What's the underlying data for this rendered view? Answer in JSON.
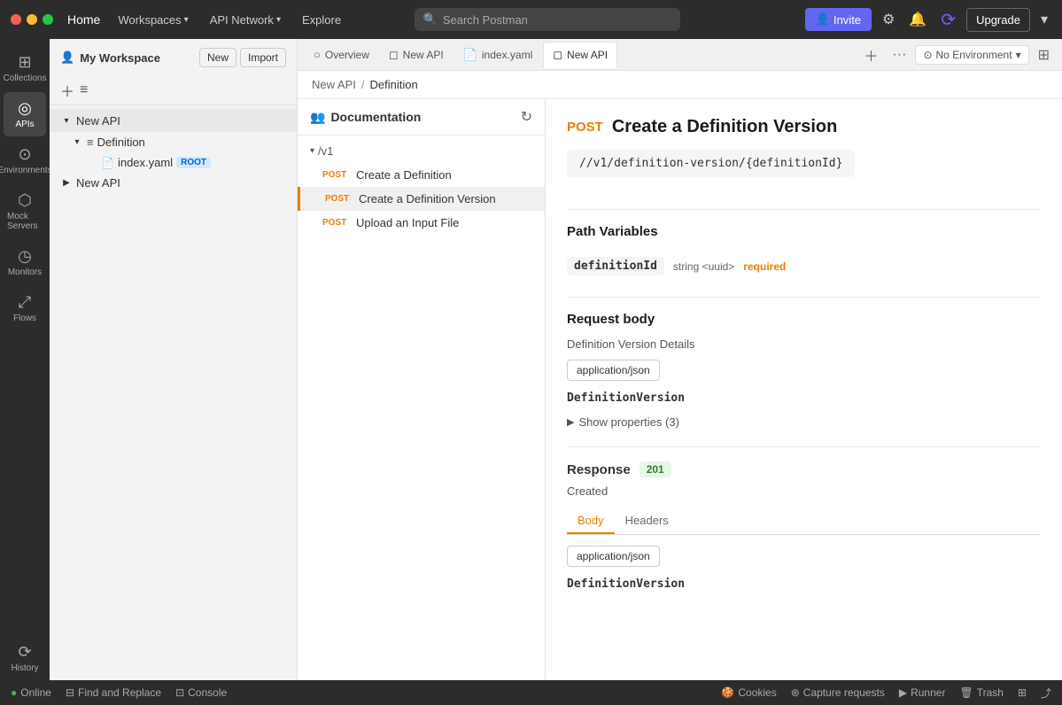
{
  "topnav": {
    "home": "Home",
    "workspaces": "Workspaces",
    "api_network": "API Network",
    "explore": "Explore",
    "search_placeholder": "Search Postman",
    "invite_label": "Invite",
    "upgrade_label": "Upgrade"
  },
  "sidebar": {
    "workspace_name": "My Workspace",
    "new_btn": "New",
    "import_btn": "Import",
    "icons": [
      {
        "id": "collections",
        "label": "Collections",
        "glyph": "⊞",
        "active": false
      },
      {
        "id": "apis",
        "label": "APIs",
        "glyph": "◎",
        "active": true
      },
      {
        "id": "environments",
        "label": "Environments",
        "glyph": "⊙",
        "active": false
      },
      {
        "id": "mock-servers",
        "label": "Mock Servers",
        "glyph": "⬡",
        "active": false
      },
      {
        "id": "monitors",
        "label": "Monitors",
        "glyph": "◷",
        "active": false
      },
      {
        "id": "flows",
        "label": "Flows",
        "glyph": "⤢",
        "active": false
      },
      {
        "id": "history",
        "label": "History",
        "glyph": "⟳",
        "active": false
      }
    ]
  },
  "tree": {
    "items": [
      {
        "id": "new-api-root",
        "label": "New API",
        "indent": 0,
        "chevron": "▾",
        "has_more": true
      },
      {
        "id": "definition",
        "label": "Definition",
        "indent": 1,
        "chevron": "▾",
        "icon": "≡"
      },
      {
        "id": "index-yaml",
        "label": "index.yaml",
        "indent": 2,
        "chevron": "",
        "icon": "📄",
        "tag": "ROOT"
      },
      {
        "id": "new-api-2",
        "label": "New API",
        "indent": 0,
        "chevron": "▶",
        "has_more": false
      }
    ]
  },
  "tabs": [
    {
      "id": "overview",
      "label": "Overview",
      "icon": "○",
      "active": false
    },
    {
      "id": "new-api-tab",
      "label": "New API",
      "icon": "◻",
      "active": false
    },
    {
      "id": "index-yaml-tab",
      "label": "index.yaml",
      "icon": "📄",
      "active": false
    },
    {
      "id": "new-api-active",
      "label": "New API",
      "icon": "◻",
      "active": true
    }
  ],
  "env_selector": {
    "label": "No Environment"
  },
  "breadcrumb": {
    "parent": "New API",
    "separator": "/",
    "current": "Definition"
  },
  "doc": {
    "title": "Documentation",
    "version": "/v1",
    "endpoints": [
      {
        "method": "POST",
        "label": "Create a Definition"
      },
      {
        "method": "POST",
        "label": "Create a Definition Version",
        "active": true
      },
      {
        "method": "POST",
        "label": "Upload an Input File"
      }
    ]
  },
  "detail": {
    "method": "POST",
    "title": "Create a Definition Version",
    "path": "//v1/definition-version/{definitionId}",
    "path_variables_title": "Path Variables",
    "path_var": {
      "name": "definitionId",
      "type": "string <uuid>",
      "required": "required"
    },
    "request_body_title": "Request body",
    "request_body_desc": "Definition Version Details",
    "content_type": "application/json",
    "schema_name": "DefinitionVersion",
    "show_props": "Show properties (3)",
    "response_title": "Response",
    "response_code": "201",
    "response_desc": "Created",
    "response_tabs": [
      "Body",
      "Headers"
    ],
    "response_content_type": "application/json",
    "response_schema": "DefinitionVersion"
  },
  "bottom_bar": {
    "online": "Online",
    "find_replace": "Find and Replace",
    "console": "Console",
    "cookies": "Cookies",
    "capture": "Capture requests",
    "runner": "Runner",
    "trash": "Trash"
  }
}
